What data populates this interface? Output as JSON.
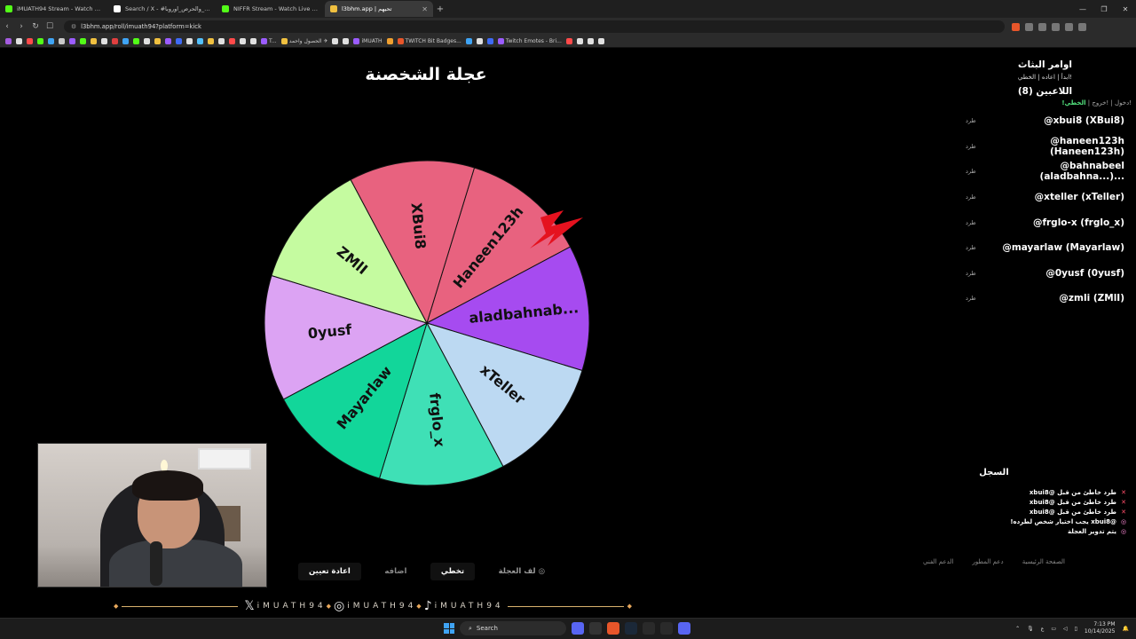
{
  "browser": {
    "tabs": [
      {
        "title": "iMUATH94 Stream - Watch Live on Ki",
        "color": "#53fc18",
        "active": false
      },
      {
        "title": "Search / X - #العاب_والحرص_اوروبا",
        "color": "#ffffff",
        "active": false
      },
      {
        "title": "NIFFR Stream - Watch Live on Kick",
        "color": "#53fc18",
        "active": false
      },
      {
        "title": "l3bhm.app | تحيهم",
        "color": "#f0c040",
        "active": true
      }
    ],
    "url": "l3bhm.app/roll/imuath94?platform=kick",
    "bookmarks": [
      "T...",
      "الحصول واحمد ✈",
      "iMUATH",
      "TWITCH Bit Badges...",
      "Twitch Emotes - Bri..."
    ]
  },
  "wheel": {
    "title": "عجلة الشخصنة",
    "segments": [
      {
        "label": "Haneen123h",
        "color": "#e8627f"
      },
      {
        "label": "aladbahnab...",
        "color": "#a64bf0"
      },
      {
        "label": "xTeller",
        "color": "#bcd9f2"
      },
      {
        "label": "frglo_x",
        "color": "#3fe0b6"
      },
      {
        "label": "Mayarlaw",
        "color": "#12d69a"
      },
      {
        "label": "0yusf",
        "color": "#dca3f3"
      },
      {
        "label": "ZMlI",
        "color": "#c5fba0"
      },
      {
        "label": "XBui8",
        "color": "#e8627f"
      }
    ]
  },
  "panel": {
    "title": "اوامر البثاث",
    "commands": "!ابدأ | اعاده | الخطي",
    "players_title": "اللاعبين (8)",
    "actions_prefix": "!دخول | !خروج |",
    "actions_highlight": "الخطي!",
    "kick_label": "طرد",
    "players": [
      "@xbui8 (XBui8)",
      "@haneen123h (Haneen123h)",
      "@bahnabeel (aladbahna...)...",
      "@xteller (xTeller)",
      "@frglo-x (frglo_x)",
      "@mayarlaw (Mayarlaw)",
      "@0yusf (0yusf)",
      "@zmli (ZMlI)"
    ]
  },
  "log": {
    "title": "السجل",
    "entries": [
      {
        "icon": "✕",
        "type": "red",
        "text": "طرد خاطئ من قبل @xbui8"
      },
      {
        "icon": "✕",
        "type": "red",
        "text": "طرد خاطئ من قبل @xbui8"
      },
      {
        "icon": "✕",
        "type": "red",
        "text": "طرد خاطئ من قبل @xbui8"
      },
      {
        "icon": "◎",
        "type": "pink",
        "text": "@xbui8 يجب اختيار شخص لطرده!"
      },
      {
        "icon": "◎",
        "type": "pink",
        "text": "يتم تدوير العجلة"
      }
    ]
  },
  "footer": {
    "home": "الصفحة الرئيسية",
    "support_dev": "دعم المطور",
    "tech_support": "الدعم الفني"
  },
  "buttons": {
    "spin": "لف العجلة",
    "skip": "تخطي",
    "add": "اضافه",
    "reset": "اعادة تعيين"
  },
  "overlay": {
    "handle1": "iMUATH94",
    "handle2": "iMUATH94",
    "handle3": "iMUATH94"
  },
  "taskbar": {
    "search": "Search",
    "time": "7:13 PM",
    "date": "10/14/2025"
  }
}
